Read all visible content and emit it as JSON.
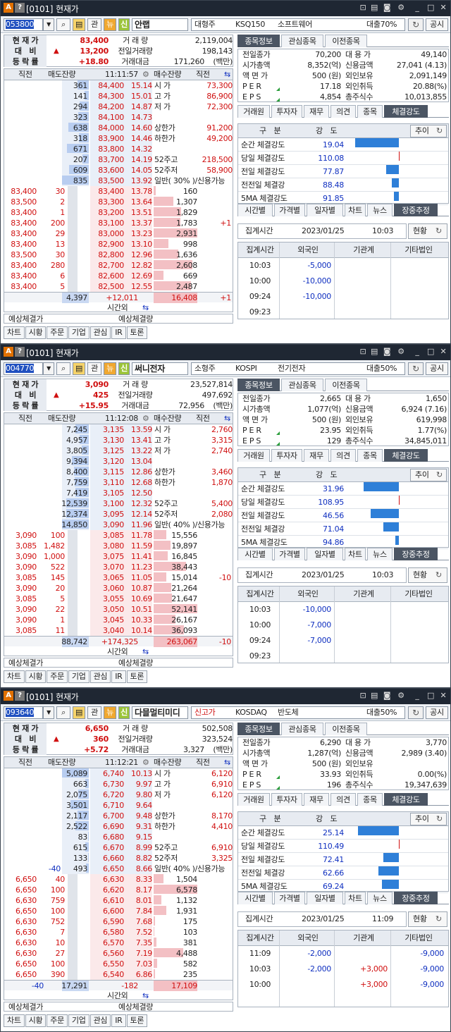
{
  "common": {
    "screen_id": "[0101]",
    "screen_title": "현재가",
    "btn_gwan": "관",
    "btn_news": "뉴",
    "btn_sin": "신",
    "btn_gongsi": "공시",
    "search": "⌕",
    "sum_labels": [
      "현 재 가",
      "대　비",
      "등 락 률"
    ],
    "sum_labels2": [
      "거 래 량",
      "전일거래량",
      "거래대금"
    ],
    "order_headers": [
      "직전",
      "매도잔량",
      "매수잔량",
      "직전"
    ],
    "expected_labels": [
      "예상체결가",
      "예상체결량"
    ],
    "time_out": "시간외",
    "bottom_btns": [
      "차트",
      "시황",
      "주문",
      "기업",
      "관심",
      "IR",
      "토론"
    ],
    "tabs_top": [
      "종목정보",
      "관심종목",
      "이전종목"
    ],
    "info_labels_left": [
      "전일종가",
      "시가총액",
      "액 면 가",
      "P E R",
      "E P S"
    ],
    "info_labels_right": [
      "대 용 가",
      "신용금액",
      "외인보유",
      "외인취득",
      "총주식수"
    ],
    "tabs_mid": [
      "거래원",
      "투자자",
      "재무",
      "의견",
      "종목",
      "체결강도"
    ],
    "st_headers": [
      "구　분",
      "강　도"
    ],
    "st_button": "추이",
    "st_labels": [
      "순간 체결강도",
      "당일 체결강도",
      "전일 체결강도",
      "전전일 체결강",
      "5MA 체결강도"
    ],
    "tabs_bot": [
      "시간별",
      "가격별",
      "일자별",
      "차트",
      "뉴스",
      "장중추정"
    ],
    "est_label": "집계시간",
    "est_date": "2023/01/25",
    "est_btn": "현황",
    "grid_headers": [
      "집계시간",
      "외국인",
      "기관계",
      "기타법인"
    ]
  },
  "windows": [
    {
      "code": "053800",
      "name": "안랩",
      "name_extra": "",
      "cap": "대형주",
      "index": "KSQ150",
      "sector": "소프트웨어",
      "loan": "대출70%",
      "price": "83,400",
      "change": "13,200",
      "rate": "+18.80",
      "volume": "2,119,004",
      "prev_volume": "198,143",
      "amount": "171,260",
      "amount_unit": "(백만)",
      "time": "11:11:57",
      "asks": [
        {
          "q": "361",
          "p": "84,400",
          "r": "15.14",
          "k": "시 가",
          "v": "73,300"
        },
        {
          "q": "141",
          "p": "84,300",
          "r": "15.01",
          "k": "고 가",
          "v": "86,900"
        },
        {
          "q": "294",
          "p": "84,200",
          "r": "14.87",
          "k": "저 가",
          "v": "72,300"
        },
        {
          "q": "323",
          "p": "84,100",
          "r": "14.73",
          "k": "",
          "v": ""
        },
        {
          "q": "638",
          "p": "84,000",
          "r": "14.60",
          "k": "상한가",
          "v": "91,200"
        },
        {
          "q": "318",
          "p": "83,900",
          "r": "14.46",
          "k": "하한가",
          "v": "49,200"
        },
        {
          "q": "671",
          "p": "83,800",
          "r": "14.32",
          "k": "",
          "v": ""
        },
        {
          "q": "207",
          "p": "83,700",
          "r": "14.19",
          "k": "52주고",
          "v": "218,500"
        },
        {
          "q": "609",
          "p": "83,600",
          "r": "14.05",
          "k": "52주저",
          "v": "58,900"
        },
        {
          "q": "835",
          "p": "83,500",
          "r": "13.92",
          "k": "일반( 30% )/신용가능",
          "v": ""
        }
      ],
      "bids": [
        {
          "lp": "83,400",
          "lq": "30",
          "p": "83,400",
          "r": "13.78",
          "q": "160",
          "rr": ""
        },
        {
          "lp": "83,500",
          "lq": "2",
          "p": "83,300",
          "r": "13.64",
          "q": "1,307",
          "rr": ""
        },
        {
          "lp": "83,400",
          "lq": "1",
          "p": "83,200",
          "r": "13.51",
          "q": "1,829",
          "rr": ""
        },
        {
          "lp": "83,400",
          "lq": "200",
          "p": "83,100",
          "r": "13.37",
          "q": "1,783",
          "rr": "+1"
        },
        {
          "lp": "83,400",
          "lq": "29",
          "p": "83,000",
          "r": "13.23",
          "q": "2,931",
          "rr": ""
        },
        {
          "lp": "83,400",
          "lq": "13",
          "p": "82,900",
          "r": "13.10",
          "q": "998",
          "rr": ""
        },
        {
          "lp": "83,500",
          "lq": "30",
          "p": "82,800",
          "r": "12.96",
          "q": "1,636",
          "rr": ""
        },
        {
          "lp": "83,400",
          "lq": "280",
          "p": "82,700",
          "r": "12.82",
          "q": "2,608",
          "rr": ""
        },
        {
          "lp": "83,400",
          "lq": "6",
          "p": "82,600",
          "r": "12.69",
          "q": "669",
          "rr": ""
        },
        {
          "lp": "83,400",
          "lq": "5",
          "p": "82,500",
          "r": "12.55",
          "q": "2,487",
          "rr": ""
        }
      ],
      "ask_total": "4,397",
      "diff": "+12,011",
      "bid_total": "16,408",
      "bid_total_chg": "+1",
      "info_left": [
        "70,200",
        "8,352(억)",
        "500 (원)",
        "17.18",
        "4,854"
      ],
      "info_right": [
        "49,140",
        "27,041 (4.13)",
        "2,091,149",
        "20.88(%)",
        "10,013,855"
      ],
      "st_values": [
        "19.04",
        "110.08",
        "77.87",
        "88.48",
        "91.85"
      ],
      "st_fill": [
        0.52,
        0.02,
        0.15,
        0.08,
        0.06
      ],
      "st_red": [
        false,
        true,
        false,
        false,
        false
      ],
      "est_time": "10:03",
      "grid": [
        {
          "t": "10:03",
          "f": "-5,000",
          "g": "",
          "e": ""
        },
        {
          "t": "10:00",
          "f": "-10,000",
          "g": "",
          "e": ""
        },
        {
          "t": "09:24",
          "f": "-10,000",
          "g": "",
          "e": ""
        },
        {
          "t": "09:23",
          "f": "",
          "g": "",
          "e": ""
        }
      ]
    },
    {
      "code": "004770",
      "name": "써니전자",
      "name_extra": "",
      "cap": "소형주",
      "index": "KOSPI",
      "sector": "전기전자",
      "loan": "대출50%",
      "price": "3,090",
      "change": "425",
      "rate": "+15.95",
      "volume": "23,527,814",
      "prev_volume": "497,692",
      "amount": "72,956",
      "amount_unit": "(백만)",
      "time": "11:12:08",
      "asks": [
        {
          "q": "7,245",
          "p": "3,135",
          "r": "13.59",
          "k": "시 가",
          "v": "2,760"
        },
        {
          "q": "4,957",
          "p": "3,130",
          "r": "13.41",
          "k": "고 가",
          "v": "3,315"
        },
        {
          "q": "3,805",
          "p": "3,125",
          "r": "13.22",
          "k": "저 가",
          "v": "2,740"
        },
        {
          "q": "9,394",
          "p": "3,120",
          "r": "13.04",
          "k": "",
          "v": ""
        },
        {
          "q": "8,400",
          "p": "3,115",
          "r": "12.86",
          "k": "상한가",
          "v": "3,460"
        },
        {
          "q": "7,759",
          "p": "3,110",
          "r": "12.68",
          "k": "하한가",
          "v": "1,870"
        },
        {
          "q": "7,419",
          "p": "3,105",
          "r": "12.50",
          "k": "",
          "v": ""
        },
        {
          "q": "12,539",
          "p": "3,100",
          "r": "12.32",
          "k": "52주고",
          "v": "5,400"
        },
        {
          "q": "12,374",
          "p": "3,095",
          "r": "12.14",
          "k": "52주저",
          "v": "2,080"
        },
        {
          "q": "14,850",
          "p": "3,090",
          "r": "11.96",
          "k": "일반( 40% )/신용가능",
          "v": ""
        }
      ],
      "bids": [
        {
          "lp": "3,090",
          "lq": "100",
          "p": "3,085",
          "r": "11.78",
          "q": "15,556",
          "rr": ""
        },
        {
          "lp": "3,085",
          "lq": "1,482",
          "p": "3,080",
          "r": "11.59",
          "q": "19,897",
          "rr": ""
        },
        {
          "lp": "3,090",
          "lq": "1,000",
          "p": "3,075",
          "r": "11.41",
          "q": "16,845",
          "rr": ""
        },
        {
          "lp": "3,090",
          "lq": "522",
          "p": "3,070",
          "r": "11.23",
          "q": "38,443",
          "rr": ""
        },
        {
          "lp": "3,085",
          "lq": "145",
          "p": "3,065",
          "r": "11.05",
          "q": "15,014",
          "rr": "-10"
        },
        {
          "lp": "3,090",
          "lq": "20",
          "p": "3,060",
          "r": "10.87",
          "q": "21,264",
          "rr": ""
        },
        {
          "lp": "3,085",
          "lq": "5",
          "p": "3,055",
          "r": "10.69",
          "q": "21,647",
          "rr": ""
        },
        {
          "lp": "3,090",
          "lq": "22",
          "p": "3,050",
          "r": "10.51",
          "q": "52,141",
          "rr": ""
        },
        {
          "lp": "3,090",
          "lq": "1",
          "p": "3,045",
          "r": "10.33",
          "q": "26,167",
          "rr": ""
        },
        {
          "lp": "3,085",
          "lq": "11",
          "p": "3,040",
          "r": "10.14",
          "q": "36,093",
          "rr": ""
        }
      ],
      "ask_total": "88,742",
      "diff": "+174,325",
      "bid_total": "263,067",
      "bid_total_chg": "-10",
      "info_left": [
        "2,665",
        "1,077(억)",
        "500 (원)",
        "23.95",
        "129"
      ],
      "info_right": [
        "1,650",
        "6,924 (7.16)",
        "619,998",
        "1.77(%)",
        "34,845,011"
      ],
      "st_values": [
        "31.96",
        "108.95",
        "46.56",
        "71.04",
        "94.86"
      ],
      "st_fill": [
        0.42,
        0.02,
        0.33,
        0.18,
        0.04
      ],
      "st_red": [
        false,
        true,
        false,
        false,
        false
      ],
      "est_time": "10:03",
      "grid": [
        {
          "t": "10:03",
          "f": "-10,000",
          "g": "",
          "e": ""
        },
        {
          "t": "10:00",
          "f": "-7,000",
          "g": "",
          "e": ""
        },
        {
          "t": "09:24",
          "f": "-7,000",
          "g": "",
          "e": ""
        },
        {
          "t": "09:23",
          "f": "",
          "g": "",
          "e": ""
        }
      ]
    },
    {
      "code": "093640",
      "name": "다믈멀티미디",
      "name_extra": "신고가",
      "cap": "",
      "index": "KOSDAQ",
      "sector": "반도체",
      "loan": "대출50%",
      "price": "6,650",
      "change": "360",
      "rate": "+5.72",
      "volume": "502,508",
      "prev_volume": "323,524",
      "amount": "3,327",
      "amount_unit": "(백만)",
      "time": "11:12:21",
      "asks": [
        {
          "q": "5,089",
          "p": "6,740",
          "r": "10.13",
          "k": "시 가",
          "v": "6,120"
        },
        {
          "q": "663",
          "p": "6,730",
          "r": "9.97",
          "k": "고 가",
          "v": "6,910"
        },
        {
          "q": "2,075",
          "p": "6,720",
          "r": "9.80",
          "k": "저 가",
          "v": "6,120"
        },
        {
          "q": "3,501",
          "p": "6,710",
          "r": "9.64",
          "k": "",
          "v": ""
        },
        {
          "q": "2,117",
          "p": "6,700",
          "r": "9.48",
          "k": "상한가",
          "v": "8,170"
        },
        {
          "q": "2,522",
          "p": "6,690",
          "r": "9.31",
          "k": "하한가",
          "v": "4,410"
        },
        {
          "q": "83",
          "p": "6,680",
          "r": "9.15",
          "k": "",
          "v": ""
        },
        {
          "q": "615",
          "p": "6,670",
          "r": "8.99",
          "k": "52주고",
          "v": "6,910"
        },
        {
          "q": "133",
          "p": "6,660",
          "r": "8.82",
          "k": "52주저",
          "v": "3,325"
        },
        {
          "q": "493",
          "p": "6,650",
          "r": "8.66",
          "k": "일반( 40% )/신용가능",
          "v": "",
          "pre": "-40"
        }
      ],
      "bids": [
        {
          "lp": "6,650",
          "lq": "40",
          "p": "6,630",
          "r": "8.33",
          "q": "1,504",
          "rr": ""
        },
        {
          "lp": "6,650",
          "lq": "100",
          "p": "6,620",
          "r": "8.17",
          "q": "6,578",
          "rr": ""
        },
        {
          "lp": "6,630",
          "lq": "759",
          "p": "6,610",
          "r": "8.01",
          "q": "1,132",
          "rr": ""
        },
        {
          "lp": "6,650",
          "lq": "100",
          "p": "6,600",
          "r": "7.84",
          "q": "1,931",
          "rr": ""
        },
        {
          "lp": "6,630",
          "lq": "752",
          "p": "6,590",
          "r": "7.68",
          "q": "175",
          "rr": ""
        },
        {
          "lp": "6,630",
          "lq": "7",
          "p": "6,580",
          "r": "7.52",
          "q": "103",
          "rr": ""
        },
        {
          "lp": "6,630",
          "lq": "10",
          "p": "6,570",
          "r": "7.35",
          "q": "381",
          "rr": ""
        },
        {
          "lp": "6,630",
          "lq": "27",
          "p": "6,560",
          "r": "7.19",
          "q": "4,488",
          "rr": ""
        },
        {
          "lp": "6,650",
          "lq": "100",
          "p": "6,550",
          "r": "7.03",
          "q": "582",
          "rr": ""
        },
        {
          "lp": "6,650",
          "lq": "390",
          "p": "6,540",
          "r": "6.86",
          "q": "235",
          "rr": ""
        }
      ],
      "ask_total": "17,291",
      "ask_total_pre": "-40",
      "diff": "-182",
      "bid_total": "17,109",
      "bid_total_chg": "",
      "info_left": [
        "6,290",
        "1,287(억)",
        "500 (원)",
        "33.93",
        "196"
      ],
      "info_right": [
        "3,770",
        "2,989 (3.40)",
        "",
        "0.00(%)",
        "19,347,639"
      ],
      "st_values": [
        "25.14",
        "110.49",
        "72.41",
        "62.66",
        "69.24"
      ],
      "st_fill": [
        0.48,
        0.02,
        0.18,
        0.24,
        0.2
      ],
      "st_red": [
        false,
        true,
        false,
        false,
        false
      ],
      "est_time": "11:09",
      "grid": [
        {
          "t": "11:09",
          "f": "-2,000",
          "g": "",
          "e": "-9,000"
        },
        {
          "t": "10:03",
          "f": "-2,000",
          "g": "+3,000",
          "e": "-9,000"
        },
        {
          "t": "10:00",
          "f": "",
          "g": "+3,000",
          "e": "-9,000"
        }
      ]
    }
  ]
}
